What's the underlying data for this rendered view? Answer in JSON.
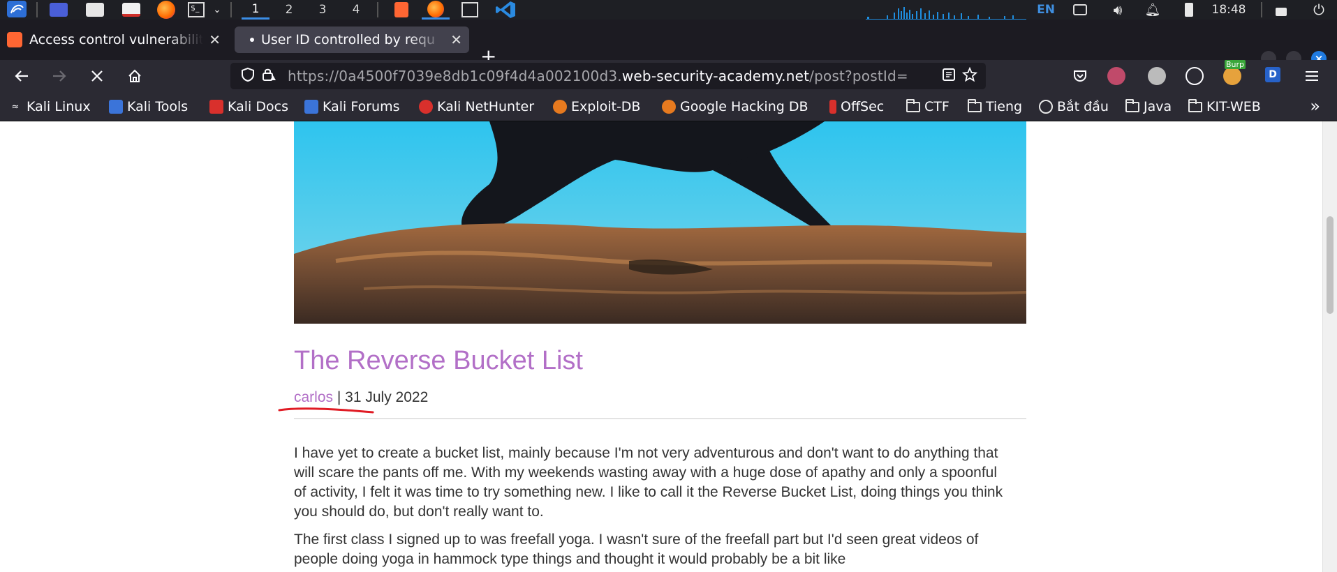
{
  "taskbar": {
    "workspaces": [
      "1",
      "2",
      "3",
      "4"
    ],
    "active_workspace": "1",
    "keyboard_layout": "EN",
    "clock": "18:48"
  },
  "tabs": [
    {
      "title": "Access control vulnerabilit",
      "selected": false,
      "favicon_color": "#ff6633"
    },
    {
      "title": "User ID controlled by requ",
      "selected": true,
      "loading": true
    }
  ],
  "tab_close_glyph": "✕",
  "new_tab_glyph": "+",
  "url": {
    "prefix": "https://0a4500f7039e8db1c09f4d4a002100d3.",
    "domain": "web-security-academy.net",
    "path": "/post?postId="
  },
  "extensions": {
    "burp_badge": "Burp",
    "d_badge": "D"
  },
  "bookmarks": [
    {
      "label": "Kali Linux",
      "icon": "kali-dragon-icon"
    },
    {
      "label": "Kali Tools",
      "icon": "kali-tools-icon"
    },
    {
      "label": "Kali Docs",
      "icon": "kali-docs-icon"
    },
    {
      "label": "Kali Forums",
      "icon": "kali-forums-icon"
    },
    {
      "label": "Kali NetHunter",
      "icon": "nethunter-icon"
    },
    {
      "label": "Exploit-DB",
      "icon": "exploit-db-icon"
    },
    {
      "label": "Google Hacking DB",
      "icon": "ghdb-icon"
    },
    {
      "label": "OffSec",
      "icon": "offsec-icon"
    },
    {
      "label": "CTF",
      "icon": "folder-icon"
    },
    {
      "label": "Tieng",
      "icon": "folder-icon"
    },
    {
      "label": "Bắt đầu",
      "icon": "globe-icon"
    },
    {
      "label": "Java",
      "icon": "folder-icon"
    },
    {
      "label": "KIT-WEB",
      "icon": "folder-icon"
    }
  ],
  "post": {
    "title": "The Reverse Bucket List",
    "author": "carlos",
    "separator": " | ",
    "date": "31 July 2022",
    "paragraphs": [
      "I have yet to create a bucket list, mainly because I'm not very adventurous and don't want to do anything that will scare the pants off me. With my weekends wasting away with a huge dose of apathy and only a spoonful of activity, I felt it was time to try something new. I like to call it the Reverse Bucket List, doing things you think you should do, but don't really want to.",
      "The first class I signed up to was freefall yoga. I wasn't sure of the freefall part but I'd seen great videos of people doing yoga in hammock type things and thought it would probably be a bit like"
    ]
  },
  "colors": {
    "accent_purple": "#b26fc7",
    "annotation_red": "#e01b24",
    "firefox_accent": "#1f7ae0"
  }
}
